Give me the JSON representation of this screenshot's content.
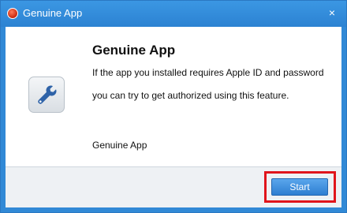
{
  "window": {
    "title": "Genuine App",
    "close_glyph": "×"
  },
  "content": {
    "heading": "Genuine App",
    "description_line1": "If the app you installed requires Apple ID and password",
    "description_line2": "you can try to get authorized using this feature.",
    "app_label": "Genuine App",
    "icon": "wrench-icon"
  },
  "footer": {
    "start_label": "Start"
  },
  "colors": {
    "titlebar": "#3189d6",
    "highlight": "#e0141b",
    "button": "#2d7ed1"
  }
}
